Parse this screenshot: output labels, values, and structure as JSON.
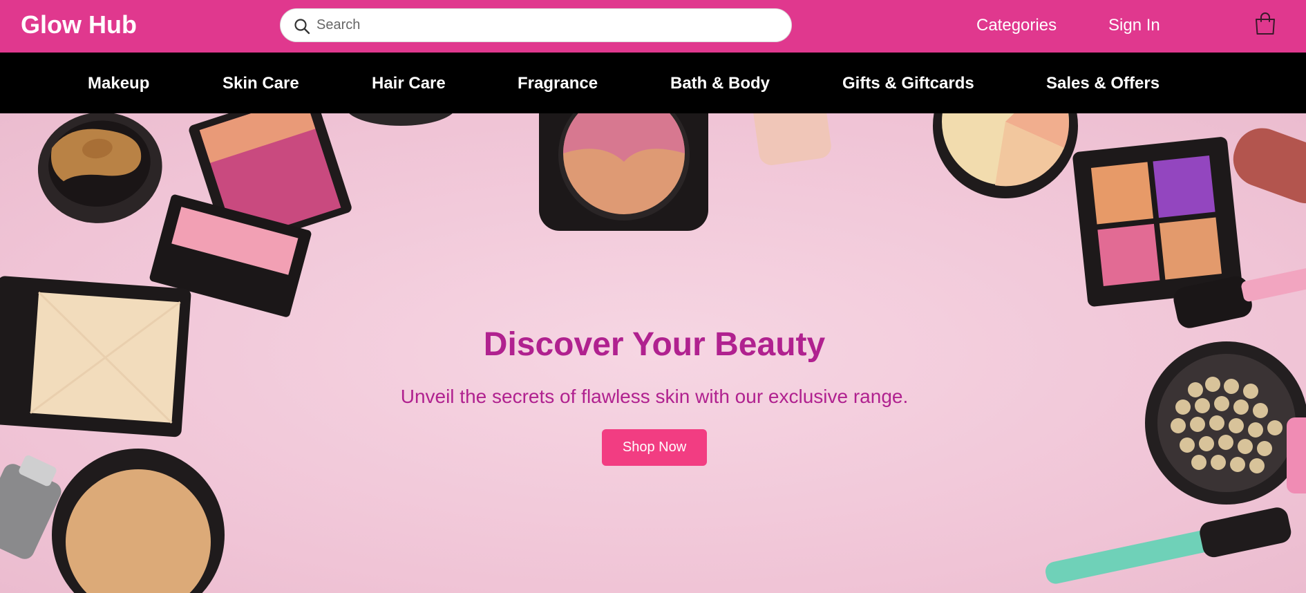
{
  "header": {
    "logo": "Glow Hub",
    "search": {
      "placeholder": "Search",
      "value": ""
    },
    "links": {
      "categories": "Categories",
      "sign_in": "Sign In"
    },
    "cart_icon": "shopping-bag-icon"
  },
  "nav": {
    "items": [
      {
        "label": "Makeup"
      },
      {
        "label": "Skin Care"
      },
      {
        "label": "Hair Care"
      },
      {
        "label": "Fragrance"
      },
      {
        "label": "Bath & Body"
      },
      {
        "label": "Gifts & Giftcards"
      },
      {
        "label": "Sales & Offers"
      }
    ]
  },
  "hero": {
    "title": "Discover Your Beauty",
    "subtitle": "Unveil the secrets of flawless skin with our exclusive range.",
    "cta_label": "Shop Now"
  },
  "colors": {
    "header_bg": "#e0388e",
    "nav_bg": "#000000",
    "hero_text": "#b0218f",
    "cta_bg": "#f23d82"
  }
}
